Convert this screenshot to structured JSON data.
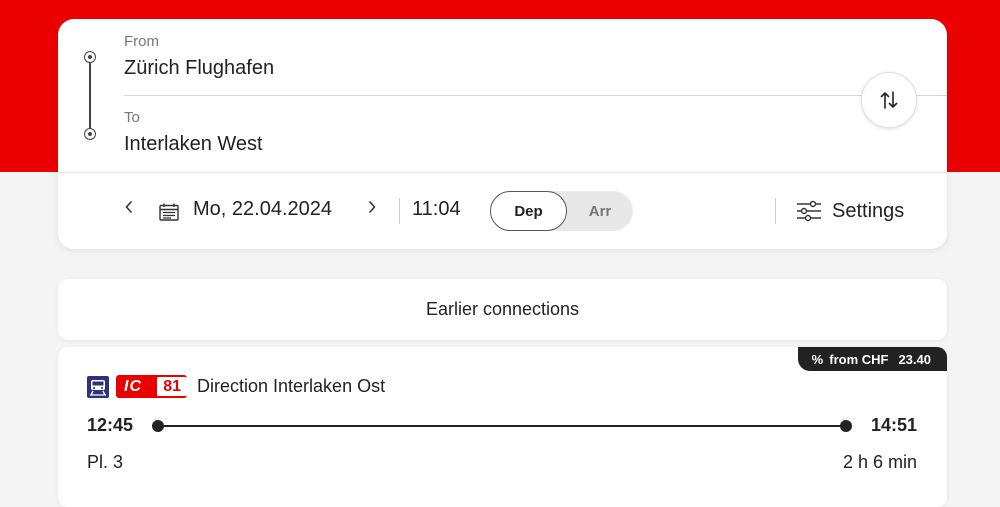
{
  "search": {
    "from": {
      "label": "From",
      "value": "Zürich Flughafen"
    },
    "to": {
      "label": "To",
      "value": "Interlaken West"
    },
    "swap_icon": "swap-arrows-icon"
  },
  "datetime": {
    "date": "Mo, 22.04.2024",
    "time": "11:04",
    "dep_label": "Dep",
    "arr_label": "Arr",
    "selected": "Dep",
    "settings_label": "Settings"
  },
  "earlier_label": "Earlier connections",
  "connection": {
    "price": {
      "percent": "%",
      "prefix": "from CHF",
      "amount": "23.40"
    },
    "product": {
      "category": "IC",
      "number": "81"
    },
    "direction": "Direction Interlaken Ost",
    "departure": "12:45",
    "arrival": "14:51",
    "platform": "Pl. 3",
    "duration": "2 h 6 min"
  },
  "colors": {
    "brand_red": "#eb0000",
    "dark": "#222222"
  }
}
